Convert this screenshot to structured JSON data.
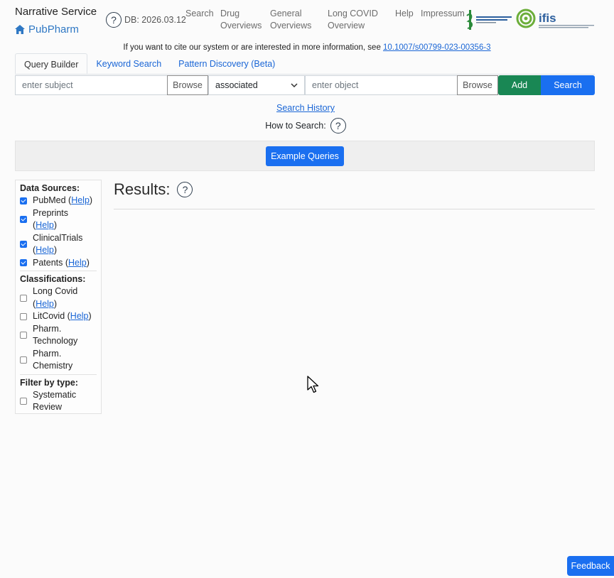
{
  "header": {
    "title": "Narrative Service",
    "subtitle": "PubPharm",
    "db_version": "DB: 2026.03.12",
    "nav": {
      "search": "Search",
      "drug1": "Drug",
      "drug2": "Overviews",
      "gen1": "General",
      "gen2": "Overviews",
      "lc1": "Long COVID",
      "lc2": "Overview",
      "help": "Help",
      "impressum": "Impressum"
    },
    "logos": {
      "tfi": "tfi-pharmazie-logo",
      "ifis": "ifis"
    }
  },
  "citation": {
    "text": "If you want to cite our system or are interested in more information, see ",
    "link": "10.1007/s00799-023-00356-3"
  },
  "tabs": [
    "Query Builder",
    "Keyword Search",
    "Pattern Discovery (Beta)"
  ],
  "query": {
    "subject_placeholder": "enter subject",
    "browse": "Browse",
    "relation": "associated",
    "object_placeholder": "enter object",
    "add": "Add",
    "search": "Search"
  },
  "history_link": "Search History",
  "how_to": "How to Search:",
  "example_queries": "Example Queries",
  "sidebar": {
    "data_sources_title": "Data Sources:",
    "pubmed": "PubMed (",
    "pubmed_help": "Help",
    "pubmed_end": ")",
    "preprints": "Preprints",
    "preprints_open": "(",
    "preprints_help": "Help",
    "preprints_end": ")",
    "clinical": "ClinicalTrials",
    "clinical_open": "(",
    "clinical_help": "Help",
    "clinical_end": ")",
    "patents": "Patents (",
    "patents_help": "Help",
    "patents_end": ")",
    "classifications_title": "Classifications:",
    "longcovid1": "Long Covid",
    "longcovid_open": "(",
    "longcovid_help": "Help",
    "longcovid_end": ")",
    "litcovid": "LitCovid (",
    "litcovid_help": "Help",
    "litcovid_end": ")",
    "pharmtech1": "Pharm.",
    "pharmtech2": "Technology",
    "pharmchem1": "Pharm.",
    "pharmchem2": "Chemistry",
    "filter_title": "Filter by type:",
    "systematic1": "Systematic",
    "systematic2": "Review"
  },
  "results_title": "Results:",
  "feedback": "Feedback"
}
